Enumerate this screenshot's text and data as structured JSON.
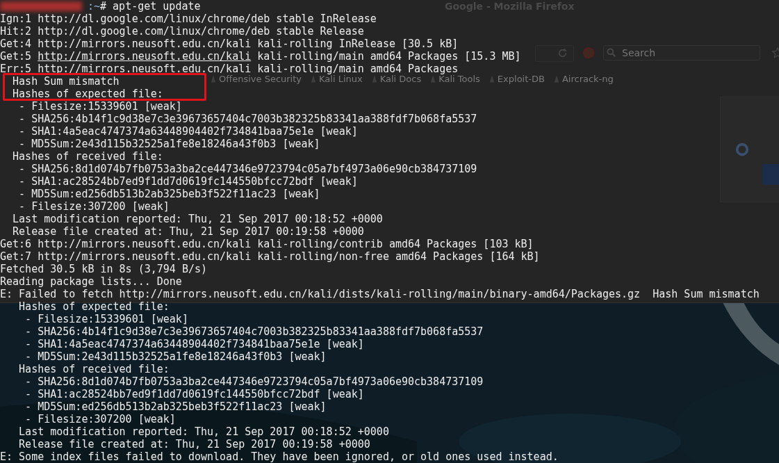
{
  "browser": {
    "title": "Google - Mozilla Firefox",
    "search_placeholder": "Search",
    "bookmarks": [
      "Offensive Security",
      "Kali Linux",
      "Kali Docs",
      "Kali Tools",
      "Exploit-DB",
      "Aircrack-ng"
    ]
  },
  "terminal": {
    "prompt": {
      "redacted_user": true,
      "path": ":~",
      "symbol": "#",
      "command": "apt-get update"
    },
    "lines": [
      {
        "kind": "plain",
        "text": "Ign:1 http://dl.google.com/linux/chrome/deb stable InRelease"
      },
      {
        "kind": "plain",
        "text": "Hit:2 http://dl.google.com/linux/chrome/deb stable Release"
      },
      {
        "kind": "plain",
        "text": "Get:4 http://mirrors.neusoft.edu.cn/kali kali-rolling InRelease [30.5 kB]"
      },
      {
        "kind": "link",
        "before": "Get:5 ",
        "link": "http://mirrors.neusoft.edu.cn/kali",
        "after": " kali-rolling/main amd64 Packages [15.3 MB]"
      },
      {
        "kind": "plain",
        "text": "Err:5 http://mirrors.neusoft.edu.cn/kali kali-rolling/main amd64 Packages"
      },
      {
        "kind": "boxed",
        "lines": [
          "  Hash Sum mismatch",
          "  Hashes of expected file:"
        ]
      },
      {
        "kind": "plain",
        "text": "   - Filesize:15339601 [weak]"
      },
      {
        "kind": "plain",
        "text": "   - SHA256:4b14f1c9d38e7c3e39673657404c7003b382325b83341aa388fdf7b068fa5537"
      },
      {
        "kind": "plain",
        "text": "   - SHA1:4a5eac4747374a63448904402f734841baa75e1e [weak]"
      },
      {
        "kind": "plain",
        "text": "   - MD5Sum:2e43d115b32525a1fe8e18246a43f0b3 [weak]"
      },
      {
        "kind": "plain",
        "text": "  Hashes of received file:"
      },
      {
        "kind": "plain",
        "text": "   - SHA256:8d1d074b7fb0753a3ba2ce447346e9723794c05a7bf4973a06e90cb384737109"
      },
      {
        "kind": "plain",
        "text": "   - SHA1:ac28524bb7ed9f1dd7d0619fc144550bfcc72bdf [weak]"
      },
      {
        "kind": "plain",
        "text": "   - MD5Sum:ed256db513b2ab325beb3f522f11ac23 [weak]"
      },
      {
        "kind": "plain",
        "text": "   - Filesize:307200 [weak]"
      },
      {
        "kind": "plain",
        "text": "  Last modification reported: Thu, 21 Sep 2017 00:18:52 +0000"
      },
      {
        "kind": "plain",
        "text": "  Release file created at: Thu, 21 Sep 2017 00:19:58 +0000"
      },
      {
        "kind": "plain",
        "text": "Get:6 http://mirrors.neusoft.edu.cn/kali kali-rolling/contrib amd64 Packages [103 kB]"
      },
      {
        "kind": "plain",
        "text": "Get:7 http://mirrors.neusoft.edu.cn/kali kali-rolling/non-free amd64 Packages [164 kB]"
      },
      {
        "kind": "plain",
        "text": "Fetched 30.5 kB in 8s (3,794 B/s)"
      },
      {
        "kind": "plain",
        "text": "Reading package lists... Done"
      },
      {
        "kind": "plain",
        "text": "E: Failed to fetch http://mirrors.neusoft.edu.cn/kali/dists/kali-rolling/main/binary-amd64/Packages.gz  Hash Sum mismatch"
      },
      {
        "kind": "plain",
        "text": "   Hashes of expected file:"
      },
      {
        "kind": "plain",
        "text": "    - Filesize:15339601 [weak]"
      },
      {
        "kind": "plain",
        "text": "    - SHA256:4b14f1c9d38e7c3e39673657404c7003b382325b83341aa388fdf7b068fa5537"
      },
      {
        "kind": "plain",
        "text": "    - SHA1:4a5eac4747374a63448904402f734841baa75e1e [weak]"
      },
      {
        "kind": "plain",
        "text": "    - MD5Sum:2e43d115b32525a1fe8e18246a43f0b3 [weak]"
      },
      {
        "kind": "plain",
        "text": "   Hashes of received file:"
      },
      {
        "kind": "plain",
        "text": "    - SHA256:8d1d074b7fb0753a3ba2ce447346e9723794c05a7bf4973a06e90cb384737109"
      },
      {
        "kind": "plain",
        "text": "    - SHA1:ac28524bb7ed9f1dd7d0619fc144550bfcc72bdf [weak]"
      },
      {
        "kind": "plain",
        "text": "    - MD5Sum:ed256db513b2ab325beb3f522f11ac23 [weak]"
      },
      {
        "kind": "plain",
        "text": "    - Filesize:307200 [weak]"
      },
      {
        "kind": "plain",
        "text": "   Last modification reported: Thu, 21 Sep 2017 00:18:52 +0000"
      },
      {
        "kind": "plain",
        "text": "   Release file created at: Thu, 21 Sep 2017 00:19:58 +0000"
      },
      {
        "kind": "plain",
        "text": "E: Some index files failed to download. They have been ignored, or old ones used instead."
      }
    ]
  }
}
